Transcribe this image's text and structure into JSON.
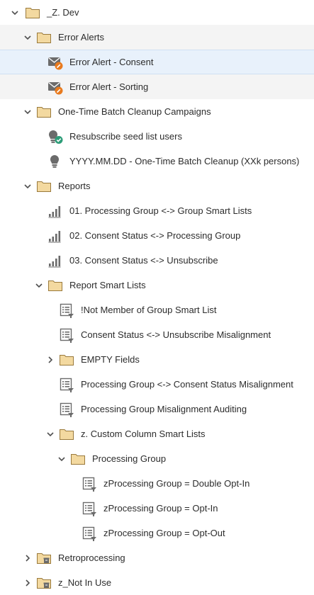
{
  "tree": {
    "items": [
      {
        "label": "_Z. Dev",
        "icon": "folder-icon",
        "chevron": "down"
      },
      {
        "label": "Error Alerts",
        "icon": "folder-icon",
        "chevron": "down"
      },
      {
        "label": "Error Alert - Consent",
        "icon": "email-edit-icon",
        "selected": true
      },
      {
        "label": "Error Alert - Sorting",
        "icon": "email-edit-icon"
      },
      {
        "label": "One-Time Batch Cleanup Campaigns",
        "icon": "folder-icon",
        "chevron": "down"
      },
      {
        "label": "Resubscribe seed list users",
        "icon": "campaign-active-icon"
      },
      {
        "label": "YYYY.MM.DD - One-Time Batch Cleanup (XXk persons)",
        "icon": "campaign-icon"
      },
      {
        "label": "Reports",
        "icon": "folder-icon",
        "chevron": "down"
      },
      {
        "label": "01. Processing Group <-> Group Smart Lists",
        "icon": "report-chart-icon"
      },
      {
        "label": "02. Consent Status <-> Processing Group",
        "icon": "report-chart-icon"
      },
      {
        "label": "03. Consent Status <-> Unsubscribe",
        "icon": "report-chart-icon"
      },
      {
        "label": "Report Smart Lists",
        "icon": "folder-icon",
        "chevron": "down"
      },
      {
        "label": "!Not Member of Group Smart List",
        "icon": "smart-list-icon"
      },
      {
        "label": "Consent Status <-> Unsubscribe Misalignment",
        "icon": "smart-list-icon"
      },
      {
        "label": "EMPTY Fields",
        "icon": "folder-icon",
        "chevron": "right"
      },
      {
        "label": "Processing Group <-> Consent Status Misalignment",
        "icon": "smart-list-icon"
      },
      {
        "label": "Processing Group Misalignment Auditing",
        "icon": "smart-list-icon"
      },
      {
        "label": "z. Custom Column Smart Lists",
        "icon": "folder-icon",
        "chevron": "down"
      },
      {
        "label": "Processing Group",
        "icon": "folder-icon",
        "chevron": "down"
      },
      {
        "label": "zProcessing Group = Double Opt-In",
        "icon": "smart-list-icon"
      },
      {
        "label": "zProcessing Group = Opt-In",
        "icon": "smart-list-icon"
      },
      {
        "label": "zProcessing Group = Opt-Out",
        "icon": "smart-list-icon"
      },
      {
        "label": "Retroprocessing",
        "icon": "archive-folder-icon",
        "chevron": "right"
      },
      {
        "label": "z_Not In Use",
        "icon": "archive-folder-icon",
        "chevron": "right"
      }
    ]
  }
}
